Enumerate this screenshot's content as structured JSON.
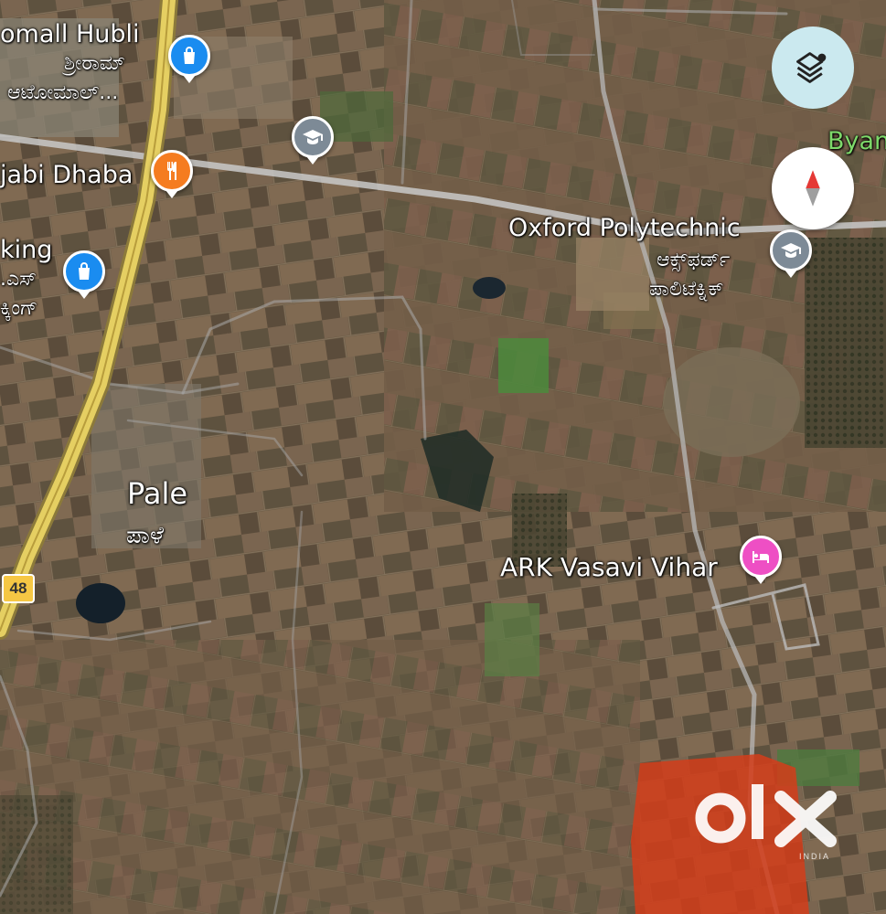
{
  "map": {
    "labels": {
      "mall_en": "omall Hubli",
      "mall_kn1": "ಶ್ರೀರಾಮ್",
      "mall_kn2": "ಆಟೋಮಾಲ್...",
      "dhaba_en": "jabi Dhaba",
      "king_en": "king",
      "king_kn1": ".ಎಸ್",
      "king_kn2": "ಕ್ಕಿಂಗ್",
      "oxford_en": "Oxford Polytechnic",
      "oxford_kn1": "ಆಕ್ಸ್‌ಫರ್ಡ್",
      "oxford_kn2": "ಪಾಲಿಟೆಕ್ನಿಕ್",
      "byan": "Byan",
      "pale_en": "Pale",
      "pale_kn": "ಪಾಳೆ",
      "ark_en": "ARK Vasavi Vihar",
      "highway": "48"
    },
    "pins": [
      {
        "name": "shopping",
        "icon": "shopping-bag-icon",
        "color": "#1a8cf0"
      },
      {
        "name": "school",
        "icon": "graduation-cap-icon",
        "color": "#7d8a96"
      },
      {
        "name": "restaurant",
        "icon": "fork-knife-icon",
        "color": "#f57c20"
      },
      {
        "name": "shopping-2",
        "icon": "shopping-bag-icon",
        "color": "#1a8cf0"
      },
      {
        "name": "polytechnic",
        "icon": "graduation-cap-icon",
        "color": "#7d8a96"
      },
      {
        "name": "hotel",
        "icon": "bed-icon",
        "color": "#ee4fc4"
      }
    ],
    "controls": {
      "layers": "layers-icon",
      "compass": "compass-icon"
    },
    "watermark": {
      "text": "OLX",
      "sub": "INDIA",
      "overlay_color": "#d33d1a"
    }
  }
}
